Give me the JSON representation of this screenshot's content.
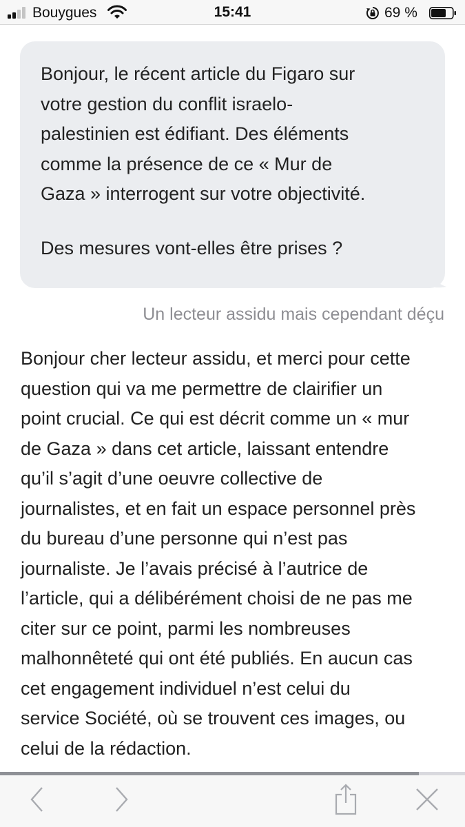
{
  "status_bar": {
    "carrier": "Bouygues",
    "time": "15:41",
    "battery_percent": "69 %",
    "signal_bars_filled": 2,
    "signal_bars_total": 4
  },
  "chat": {
    "question_lines": "Bonjour, le récent article du Figaro sur\nvotre gestion du conflit israelo-\npalestinien est édifiant. Des éléments\ncomme la présence de ce « Mur de\nGaza » interrogent sur votre objectivité.",
    "question_followup": "Des mesures vont-elles être prises ?",
    "signature": "Un lecteur assidu mais cependant déçu",
    "answer_lines": "Bonjour cher lecteur assidu, et merci pour cette\nquestion qui va me permettre de clairifier un\npoint crucial. Ce qui est décrit comme un « mur\nde Gaza » dans cet article, laissant entendre\nqu’il s’agit d’une oeuvre collective de\njournalistes, et en fait un espace personnel près\ndu bureau d’une personne qui n’est pas\njournaliste. Je l’avais précisé à l’autrice de\nl’article, qui a délibérément choisi de ne pas me\nciter sur ce point, parmi les nombreuses\nmalhonnêteté qui ont été publiés. En aucun cas\ncet engagement individuel n’est celui du\nservice Société, où se trouvent ces images, ou\ncelui de la rédaction."
  },
  "toolbar": {
    "reading_progress": 0.9,
    "icons": [
      "back-icon",
      "forward-icon",
      "share-icon",
      "close-icon"
    ]
  },
  "colors": {
    "bubble": "#ebedf0",
    "signature": "#8e8e93",
    "text": "#222222",
    "toolbar_icon": "#a9abb0",
    "progress": "#8f9196"
  }
}
